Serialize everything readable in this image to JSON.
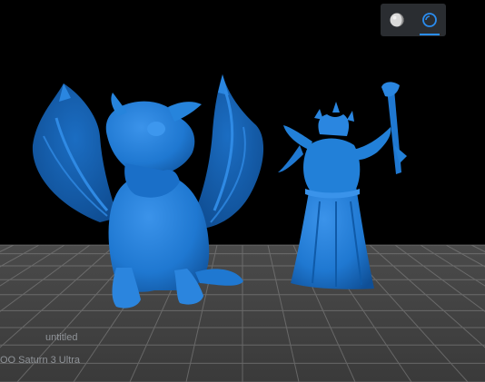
{
  "toolbar": {
    "buttons": [
      {
        "name": "shaded-view",
        "icon": "sphere-shaded-icon",
        "active": false
      },
      {
        "name": "xray-view",
        "icon": "sphere-outline-icon",
        "active": true
      }
    ]
  },
  "viewport": {
    "background_color": "#000000",
    "model_color": "#1f78d1",
    "grid_color": "#6b6b6b",
    "models": [
      "dragon",
      "wizard"
    ]
  },
  "status": {
    "project_name": "untitled",
    "printer_name": "OO Saturn 3 Ultra"
  },
  "colors": {
    "accent": "#2a8df0",
    "toolbar_bg": "#2a2d31"
  }
}
